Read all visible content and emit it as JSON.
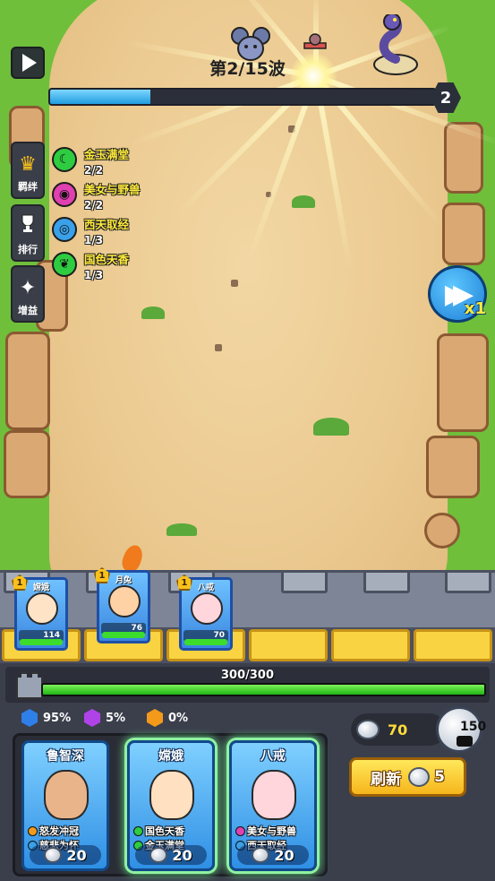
{
  "game": {
    "wave_label": "第2/15波",
    "wave_progress": 0.26,
    "wave_badge": "2",
    "speed_multiplier": "x1"
  },
  "side_menu": [
    {
      "label": "羁绊",
      "icon": "crown-icon",
      "glyph": "♛"
    },
    {
      "label": "排行",
      "icon": "trophy-icon",
      "glyph": "🏆"
    },
    {
      "label": "增益",
      "icon": "magic-wand-icon",
      "glyph": "✦"
    }
  ],
  "bonds": [
    {
      "name": "金玉满堂",
      "count": "2/2",
      "color": "#2ecc40",
      "icon": "moon-icon",
      "glyph": "☾"
    },
    {
      "name": "美女与野兽",
      "count": "2/2",
      "color": "#e040b0",
      "icon": "lips-icon",
      "glyph": "◉"
    },
    {
      "name": "西天取经",
      "count": "1/3",
      "color": "#3aa0e8",
      "icon": "swirl-icon",
      "glyph": "◎"
    },
    {
      "name": "国色天香",
      "count": "1/3",
      "color": "#2ecc40",
      "icon": "leaf-icon",
      "glyph": "❦"
    }
  ],
  "deployed_heroes": [
    {
      "name": "嫦娥",
      "level": "1",
      "attack": "114",
      "hp": 1.0
    },
    {
      "name": "月兔",
      "level": "1",
      "attack": "76",
      "hp": 1.0
    },
    {
      "name": "八戒",
      "level": "1",
      "attack": "70",
      "hp": 1.0
    }
  ],
  "base": {
    "hp_text": "300/300",
    "hp_fraction": 1.0
  },
  "odds": [
    {
      "value": "95%",
      "color": "#2f7fe8"
    },
    {
      "value": "5%",
      "color": "#b043e8"
    },
    {
      "value": "0%",
      "color": "#f39a1a"
    }
  ],
  "shop": [
    {
      "name": "鲁智深",
      "tags": [
        {
          "text": "怒发冲冠",
          "color": "#f39a1a"
        },
        {
          "text": "慈悲为怀",
          "color": "#3aa0e8"
        }
      ],
      "price": "20",
      "highlight": false
    },
    {
      "name": "嫦娥",
      "tags": [
        {
          "text": "国色天香",
          "color": "#2ecc40"
        },
        {
          "text": "金玉满堂",
          "color": "#2ecc40"
        }
      ],
      "price": "20",
      "highlight": true
    },
    {
      "name": "八戒",
      "tags": [
        {
          "text": "美女与野兽",
          "color": "#e040b0"
        },
        {
          "text": "西天取经",
          "color": "#3aa0e8"
        }
      ],
      "price": "20",
      "highlight": true
    }
  ],
  "currency": {
    "silver": "70",
    "ad_reward": "150"
  },
  "refresh": {
    "label": "刷新",
    "cost": "5"
  }
}
